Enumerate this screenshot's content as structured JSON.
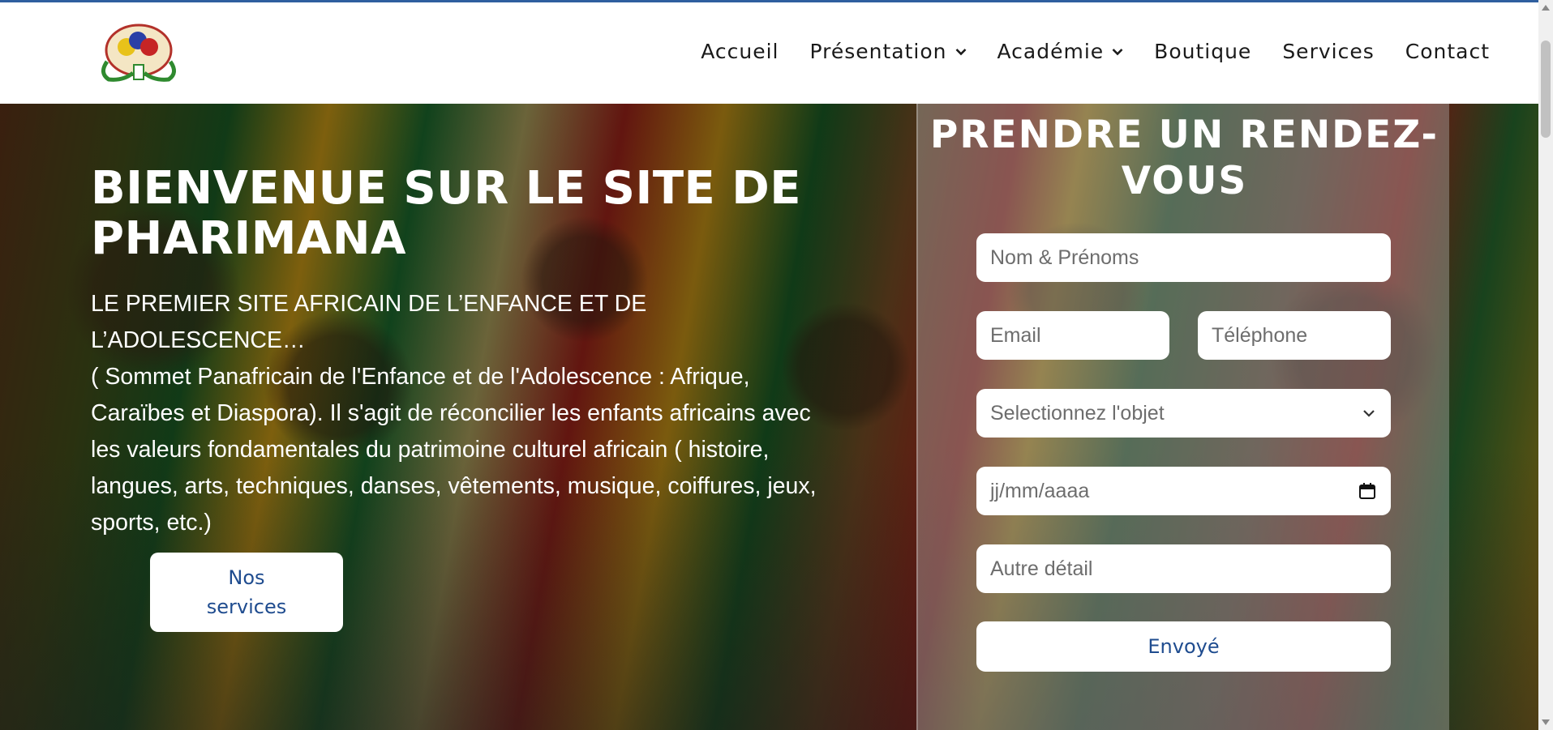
{
  "nav": {
    "items": [
      {
        "label": "Accueil",
        "dropdown": false
      },
      {
        "label": "Présentation",
        "dropdown": true
      },
      {
        "label": "Académie",
        "dropdown": true
      },
      {
        "label": "Boutique",
        "dropdown": false
      },
      {
        "label": "Services",
        "dropdown": false
      },
      {
        "label": "Contact",
        "dropdown": false
      }
    ]
  },
  "hero": {
    "title": "BIENVENUE SUR LE SITE DE PHARIMANA",
    "subtitle_line1": "LE PREMIER SITE AFRICAIN DE L’ENFANCE ET DE L’ADOLESCENCE…",
    "subtitle_rest": "( Sommet Panafricain de l'Enfance et de l'Adolescence : Afrique, Caraïbes et Diaspora). Il s'agit de réconcilier les enfants africains avec les valeurs fondamentales du patrimoine culturel africain ( histoire, langues, arts, techniques, danses, vêtements, musique, coiffures, jeux, sports, etc.)",
    "button_label": "Nos services"
  },
  "form": {
    "title": "PRENDRE UN RENDEZ-VOUS",
    "name_placeholder": "Nom & Prénoms",
    "email_placeholder": "Email",
    "phone_placeholder": "Téléphone",
    "object_placeholder": "Selectionnez l'objet",
    "date_placeholder": "jj/mm/aaaa",
    "detail_placeholder": "Autre détail",
    "submit_label": "Envoyé"
  },
  "colors": {
    "accent": "#1f4c8f",
    "topline": "#2f5f9f"
  }
}
